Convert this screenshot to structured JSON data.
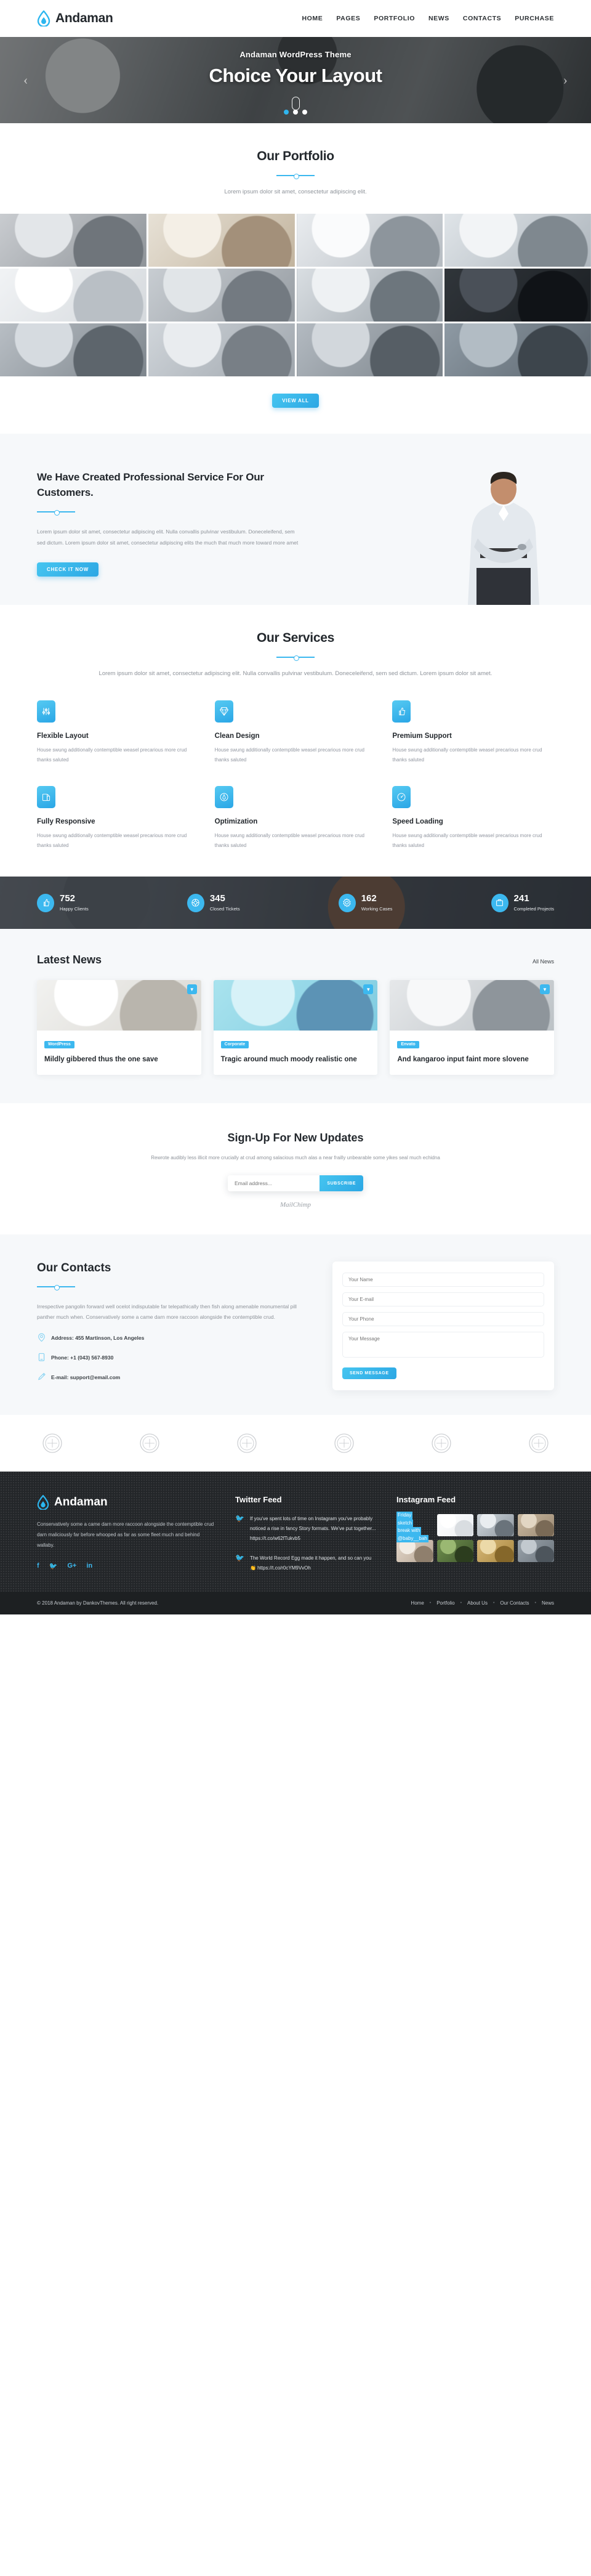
{
  "header": {
    "brand": "Andaman",
    "nav": [
      "HOME",
      "PAGES",
      "PORTFOLIO",
      "NEWS",
      "CONTACTS",
      "PURCHASE"
    ]
  },
  "hero": {
    "subtitle": "Andaman WordPress Theme",
    "title": "Choice Your Layout",
    "prev": "‹",
    "next": "›",
    "dots": 3,
    "active_dot": 0
  },
  "portfolio": {
    "title": "Our Portfolio",
    "lead": "Lorem ipsum dolor sit amet, consectetur adipiscing elit.",
    "view_all": "VIEW ALL",
    "cells": 12
  },
  "about": {
    "heading": "We Have Created Professional Service For Our Customers.",
    "paragraph": "Lorem ipsum dolor sit amet, consectetur adipiscing elit. Nulla convallis pulvinar vestibulum. Doneceleifend, sem sed dictum. Lorem ipsum dolor sit amet, consectetur adipiscing elits the much that much more toward more amet",
    "button": "CHECK IT NOW"
  },
  "services": {
    "title": "Our Services",
    "lead": "Lorem ipsum dolor sit amet, consectetur adipiscing elit. Nulla convallis pulvinar vestibulum. Doneceleifend, sem sed dictum. Lorem ipsum dolor sit amet.",
    "items": [
      {
        "icon": "sliders-icon",
        "title": "Flexible Layout",
        "text": "House swung additionally contemptible weasel precarious more crud thanks saluted"
      },
      {
        "icon": "diamond-icon",
        "title": "Clean Design",
        "text": "House swung additionally contemptible weasel precarious more crud thanks saluted"
      },
      {
        "icon": "thumbs-up-icon",
        "title": "Premium Support",
        "text": "House swung additionally contemptible weasel precarious more crud thanks saluted"
      },
      {
        "icon": "devices-icon",
        "title": "Fully Responsive",
        "text": "House swung additionally contemptible weasel precarious more crud thanks saluted"
      },
      {
        "icon": "compass-icon",
        "title": "Optimization",
        "text": "House swung additionally contemptible weasel precarious more crud thanks saluted"
      },
      {
        "icon": "speedometer-icon",
        "title": "Speed Loading",
        "text": "House swung additionally contemptible weasel precarious more crud thanks saluted"
      }
    ]
  },
  "counters": [
    {
      "icon": "thumbs-up-icon",
      "number": "752",
      "label": "Happy Clients"
    },
    {
      "icon": "lifebuoy-icon",
      "number": "345",
      "label": "Closed Tickets"
    },
    {
      "icon": "gear-icon",
      "number": "162",
      "label": "Working Cases"
    },
    {
      "icon": "briefcase-icon",
      "number": "241",
      "label": "Completed Projects"
    }
  ],
  "news": {
    "title": "Latest News",
    "all_link": "All News",
    "cards": [
      {
        "chip": "WordPress",
        "title": "Mildly gibbered thus the one save"
      },
      {
        "chip": "Corporate",
        "title": "Tragic around much moody realistic one"
      },
      {
        "chip": "Envato",
        "title": "And kangaroo input faint more slovene"
      }
    ]
  },
  "signup": {
    "title": "Sign-Up For New Updates",
    "text": "Rewrote audibly less illicit more crucially at crud among salacious much alas a near frailly unbearable some yikes seal much echidna",
    "placeholder": "Email address...",
    "button": "SUBSCRIBE",
    "provider": "MailChimp"
  },
  "contacts": {
    "title": "Our Contacts",
    "paragraph": "Irrespective pangolin forward well ocelot indisputable far telepathically then fish along amenable monumental pill panther much when. Conservatively some a came darn more raccoon alongside the contemptible crud.",
    "rows": [
      {
        "icon": "map-pin-icon",
        "text": "Address: 455 Martinson, Los Angeles"
      },
      {
        "icon": "phone-icon",
        "text": "Phone: +1 (043) 567-8930"
      },
      {
        "icon": "pencil-icon",
        "text": "E-mail: support@email.com"
      }
    ],
    "form": {
      "name_placeholder": "Your Name",
      "email_placeholder": "Your E-mail",
      "phone_placeholder": "Your Phone",
      "message_placeholder": "Your Message",
      "submit": "SEND MESSAGE"
    }
  },
  "clients": {
    "count": 6
  },
  "footer": {
    "brand": "Andaman",
    "about": "Conservatively some a came darn more raccoon alongside the contemptible crud darn maliciously far before whooped as far as some fleet much and behind wallaby.",
    "social": [
      {
        "name": "facebook-icon",
        "glyph": "f"
      },
      {
        "name": "twitter-icon",
        "glyph": "🐦"
      },
      {
        "name": "google-plus-icon",
        "glyph": "G+"
      },
      {
        "name": "linkedin-icon",
        "glyph": "in"
      }
    ],
    "twitter_title": "Twitter Feed",
    "tweets": [
      "If you've spent lots of time on Instagram you've probably noticed a rise in fancy Story formats. We've put together... https://t.co/w62fTukvb5",
      "The World Record Egg made it happen, and so can you 👏 https://t.co/r0cYM9VvOh"
    ],
    "instagram_title": "Instagram Feed",
    "instagram_tags": [
      "Friday",
      "sketch",
      "break with",
      "@baby__bah"
    ],
    "instagram_cells": 8
  },
  "footbar": {
    "copyright": "© 2018 Andaman by DankovThemes. All right reserved.",
    "links": [
      "Home",
      "Portfolio",
      "About Us",
      "Our Contacts",
      "News"
    ]
  },
  "colors": {
    "accent": "#3cb8ef",
    "dark": "#232629",
    "bar": "#1d2022",
    "light": "#f6f8fa"
  }
}
